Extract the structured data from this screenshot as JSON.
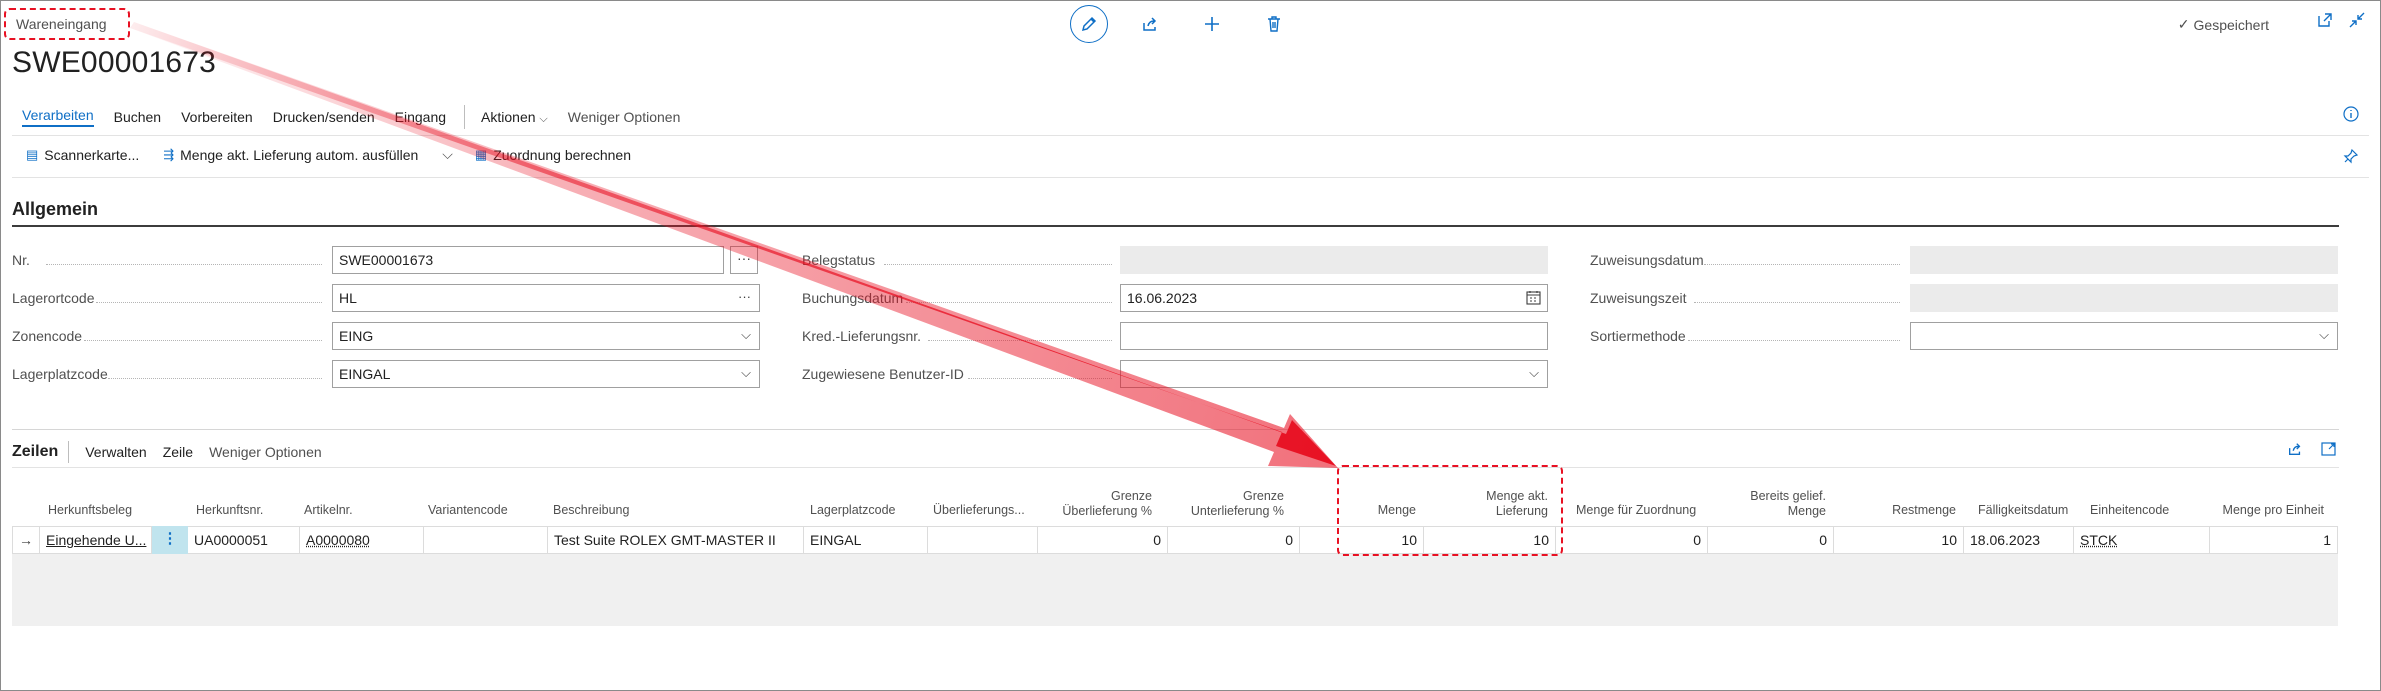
{
  "header": {
    "breadcrumb": "Wareneingang",
    "title": "SWE00001673",
    "saved_status": "Gespeichert"
  },
  "actionbar": {
    "tabs": [
      "Verarbeiten",
      "Buchen",
      "Vorbereiten",
      "Drucken/senden",
      "Eingang"
    ],
    "actions": "Aktionen",
    "fewer_options": "Weniger Optionen"
  },
  "toolbar": {
    "scanner": "Scannerkarte...",
    "autofill": "Menge akt. Lieferung autom. ausfüllen",
    "assign": "Zuordnung berechnen"
  },
  "general": {
    "title": "Allgemein",
    "col1": [
      {
        "label": "Nr.",
        "value": "SWE00001673"
      },
      {
        "label": "Lagerortcode",
        "value": "HL"
      },
      {
        "label": "Zonencode",
        "value": "EING"
      },
      {
        "label": "Lagerplatzcode",
        "value": "EINGAL"
      }
    ],
    "col2": [
      {
        "label": "Belegstatus",
        "value": ""
      },
      {
        "label": "Buchungsdatum",
        "value": "16.06.2023"
      },
      {
        "label": "Kred.-Lieferungsnr.",
        "value": ""
      },
      {
        "label": "Zugewiesene Benutzer-ID",
        "value": ""
      }
    ],
    "col3": [
      {
        "label": "Zuweisungsdatum",
        "value": ""
      },
      {
        "label": "Zuweisungszeit",
        "value": ""
      },
      {
        "label": "Sortiermethode",
        "value": ""
      }
    ]
  },
  "lines": {
    "title": "Zeilen",
    "menu": [
      "Verwalten",
      "Zeile"
    ],
    "fewer_options": "Weniger Optionen",
    "headers": {
      "source_doc": "Herkunftsbeleg",
      "source_no": "Herkunftsnr.",
      "item_no": "Artikelnr.",
      "variant": "Variantencode",
      "description": "Beschreibung",
      "bin": "Lagerplatzcode",
      "overdelivery": "Überlieferungs...",
      "limit_over_1": "Grenze",
      "limit_over_2": "Überlieferung %",
      "limit_under_1": "Grenze",
      "limit_under_2": "Unterlieferung %",
      "qty": "Menge",
      "qty_current_1": "Menge akt.",
      "qty_current_2": "Lieferung",
      "qty_assign": "Menge für Zuordnung",
      "qty_delivered_1": "Bereits gelief.",
      "qty_delivered_2": "Menge",
      "rest": "Restmenge",
      "due": "Fälligkeitsdatum",
      "uom": "Einheitencode",
      "qty_per_unit": "Menge pro Einheit"
    },
    "row": {
      "source_doc": "Eingehende U...",
      "source_no": "UA0000051",
      "item_no": "A0000080",
      "variant": "",
      "description": "Test Suite ROLEX GMT-MASTER II",
      "bin": "EINGAL",
      "overdelivery": "",
      "limit_over": "0",
      "limit_under": "0",
      "qty": "10",
      "qty_current": "10",
      "qty_assign": "0",
      "qty_delivered": "0",
      "rest": "10",
      "due": "18.06.2023",
      "uom": "STCK",
      "qty_per_unit": "1"
    }
  },
  "colors": {
    "accent": "#0f6fc6",
    "annotation": "#e81123"
  }
}
